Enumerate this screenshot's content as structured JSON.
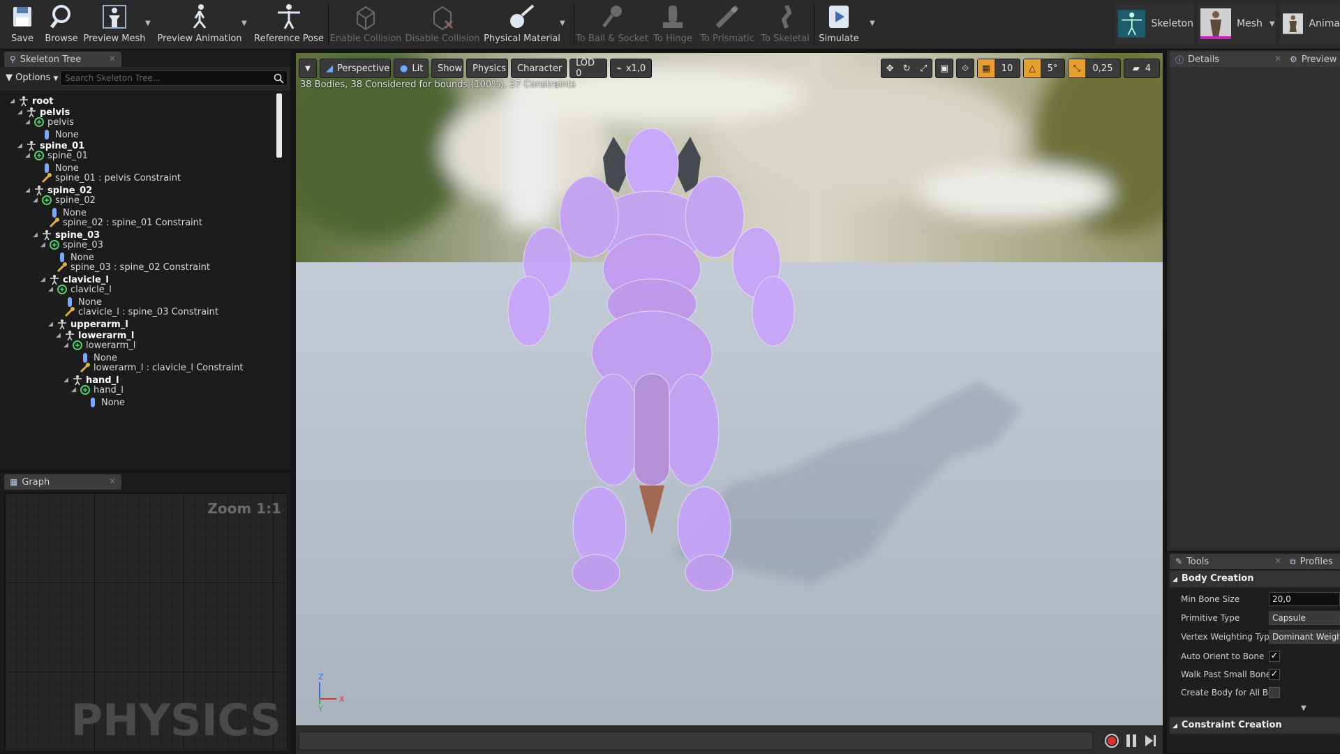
{
  "toolbar": {
    "save": "Save",
    "browse": "Browse",
    "preview_mesh": "Preview Mesh",
    "preview_animation": "Preview Animation",
    "reference_pose": "Reference Pose",
    "enable_collision": "Enable Collision",
    "disable_collision": "Disable Collision",
    "physical_material": "Physical Material",
    "to_ball_socket": "To Ball & Socket",
    "to_hinge": "To Hinge",
    "to_prismatic": "To Prismatic",
    "to_skeletal": "To Skeletal",
    "simulate": "Simulate"
  },
  "modes": {
    "skeleton": "Skeleton",
    "mesh": "Mesh",
    "animation": "Anima"
  },
  "skeleton_tree": {
    "tab_label": "Skeleton Tree",
    "options_label": "Options",
    "search_placeholder": "Search Skeleton Tree...",
    "rows": [
      {
        "text": "root",
        "type": "bone",
        "bold": true
      },
      {
        "text": "pelvis",
        "type": "bone",
        "bold": true
      },
      {
        "text": "pelvis",
        "type": "body",
        "bold": false
      },
      {
        "text": "None",
        "type": "shape",
        "bold": false
      },
      {
        "text": "spine_01",
        "type": "bone",
        "bold": true
      },
      {
        "text": "spine_01",
        "type": "body",
        "bold": false
      },
      {
        "text": "None",
        "type": "shape",
        "bold": false
      },
      {
        "text": "spine_01 : pelvis Constraint",
        "type": "constraint",
        "bold": false
      },
      {
        "text": "spine_02",
        "type": "bone",
        "bold": true
      },
      {
        "text": "spine_02",
        "type": "body",
        "bold": false
      },
      {
        "text": "None",
        "type": "shape",
        "bold": false
      },
      {
        "text": "spine_02 : spine_01 Constraint",
        "type": "constraint",
        "bold": false
      },
      {
        "text": "spine_03",
        "type": "bone",
        "bold": true
      },
      {
        "text": "spine_03",
        "type": "body",
        "bold": false
      },
      {
        "text": "None",
        "type": "shape",
        "bold": false
      },
      {
        "text": "spine_03 : spine_02 Constraint",
        "type": "constraint",
        "bold": false
      },
      {
        "text": "clavicle_l",
        "type": "bone",
        "bold": true
      },
      {
        "text": "clavicle_l",
        "type": "body",
        "bold": false
      },
      {
        "text": "None",
        "type": "shape",
        "bold": false
      },
      {
        "text": "clavicle_l : spine_03 Constraint",
        "type": "constraint",
        "bold": false
      },
      {
        "text": "upperarm_l",
        "type": "bone",
        "bold": true
      },
      {
        "text": "lowerarm_l",
        "type": "bone",
        "bold": true
      },
      {
        "text": "lowerarm_l",
        "type": "body",
        "bold": false
      },
      {
        "text": "None",
        "type": "shape",
        "bold": false
      },
      {
        "text": "lowerarm_l : clavicle_l Constraint",
        "type": "constraint",
        "bold": false
      },
      {
        "text": "hand_l",
        "type": "bone",
        "bold": true
      },
      {
        "text": "hand_l",
        "type": "body",
        "bold": false
      },
      {
        "text": "None",
        "type": "shape",
        "bold": false
      }
    ]
  },
  "graph": {
    "tab_label": "Graph",
    "zoom": "Zoom 1:1",
    "watermark": "PHYSICS"
  },
  "viewport": {
    "perspective": "Perspective",
    "lit": "Lit",
    "show": "Show",
    "physics": "Physics",
    "character": "Character",
    "lod": "LOD 0",
    "speed": "x1,0",
    "grid_snap": "10",
    "rot_snap": "5°",
    "scale_snap": "0,25",
    "cam_speed": "4",
    "bodies_info": "38 Bodies, 38 Considered for bounds (100%), 37 Constraints",
    "axis_z": "Z",
    "axis_x": "X",
    "axis_y": "Y"
  },
  "details": {
    "tab_label": "Details",
    "preview_tab": "Preview"
  },
  "tools": {
    "tab_label": "Tools",
    "profiles_tab": "Profiles",
    "body_creation": "Body Creation",
    "min_bone_size_label": "Min Bone Size",
    "min_bone_size_value": "20,0",
    "primitive_type_label": "Primitive Type",
    "primitive_type_value": "Capsule",
    "vertex_weighting_label": "Vertex Weighting Type",
    "vertex_weighting_value": "Dominant Weight",
    "auto_orient_label": "Auto Orient to Bone",
    "auto_orient_checked": true,
    "walk_past_label": "Walk Past Small Bones",
    "walk_past_checked": true,
    "create_body_label": "Create Body for All Bones",
    "create_body_checked": false,
    "constraint_creation": "Constraint Creation"
  },
  "colors": {
    "accent_orange": "#e8a02c",
    "record_red": "#e03030",
    "body_purple": "#c9a6ff"
  }
}
